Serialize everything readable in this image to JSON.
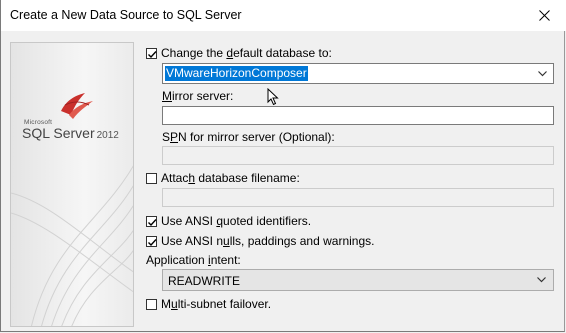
{
  "window": {
    "title": "Create a New Data Source to SQL Server"
  },
  "banner": {
    "logo_small": "Microsoft",
    "logo_main": "SQL Server",
    "logo_version": "2012"
  },
  "form": {
    "change_default_db": {
      "checked": true,
      "label_pre": "Change the ",
      "label_u": "d",
      "label_post": "efault database to:"
    },
    "database_combo": {
      "value": "VMwareHorizonComposer"
    },
    "mirror_server": {
      "label_u": "M",
      "label_post": "irror server:",
      "value": ""
    },
    "spn_mirror": {
      "label_pre": "S",
      "label_u": "P",
      "label_post": "N for mirror server (Optional):",
      "value": ""
    },
    "attach_db": {
      "checked": false,
      "label_pre": "Attac",
      "label_u": "h",
      "label_post": " database filename:",
      "value": ""
    },
    "ansi_quoted": {
      "checked": true,
      "label_pre": "Use ANSI ",
      "label_u": "q",
      "label_post": "uoted identifiers."
    },
    "ansi_nulls": {
      "checked": true,
      "label_pre": "Use ANSI n",
      "label_u": "u",
      "label_post": "lls, paddings and warnings."
    },
    "app_intent": {
      "label_pre": "Application ",
      "label_u": "i",
      "label_post": "ntent:",
      "value": "READWRITE"
    },
    "multi_subnet": {
      "checked": false,
      "label_pre": "M",
      "label_u": "u",
      "label_post": "lti-subnet failover."
    }
  }
}
